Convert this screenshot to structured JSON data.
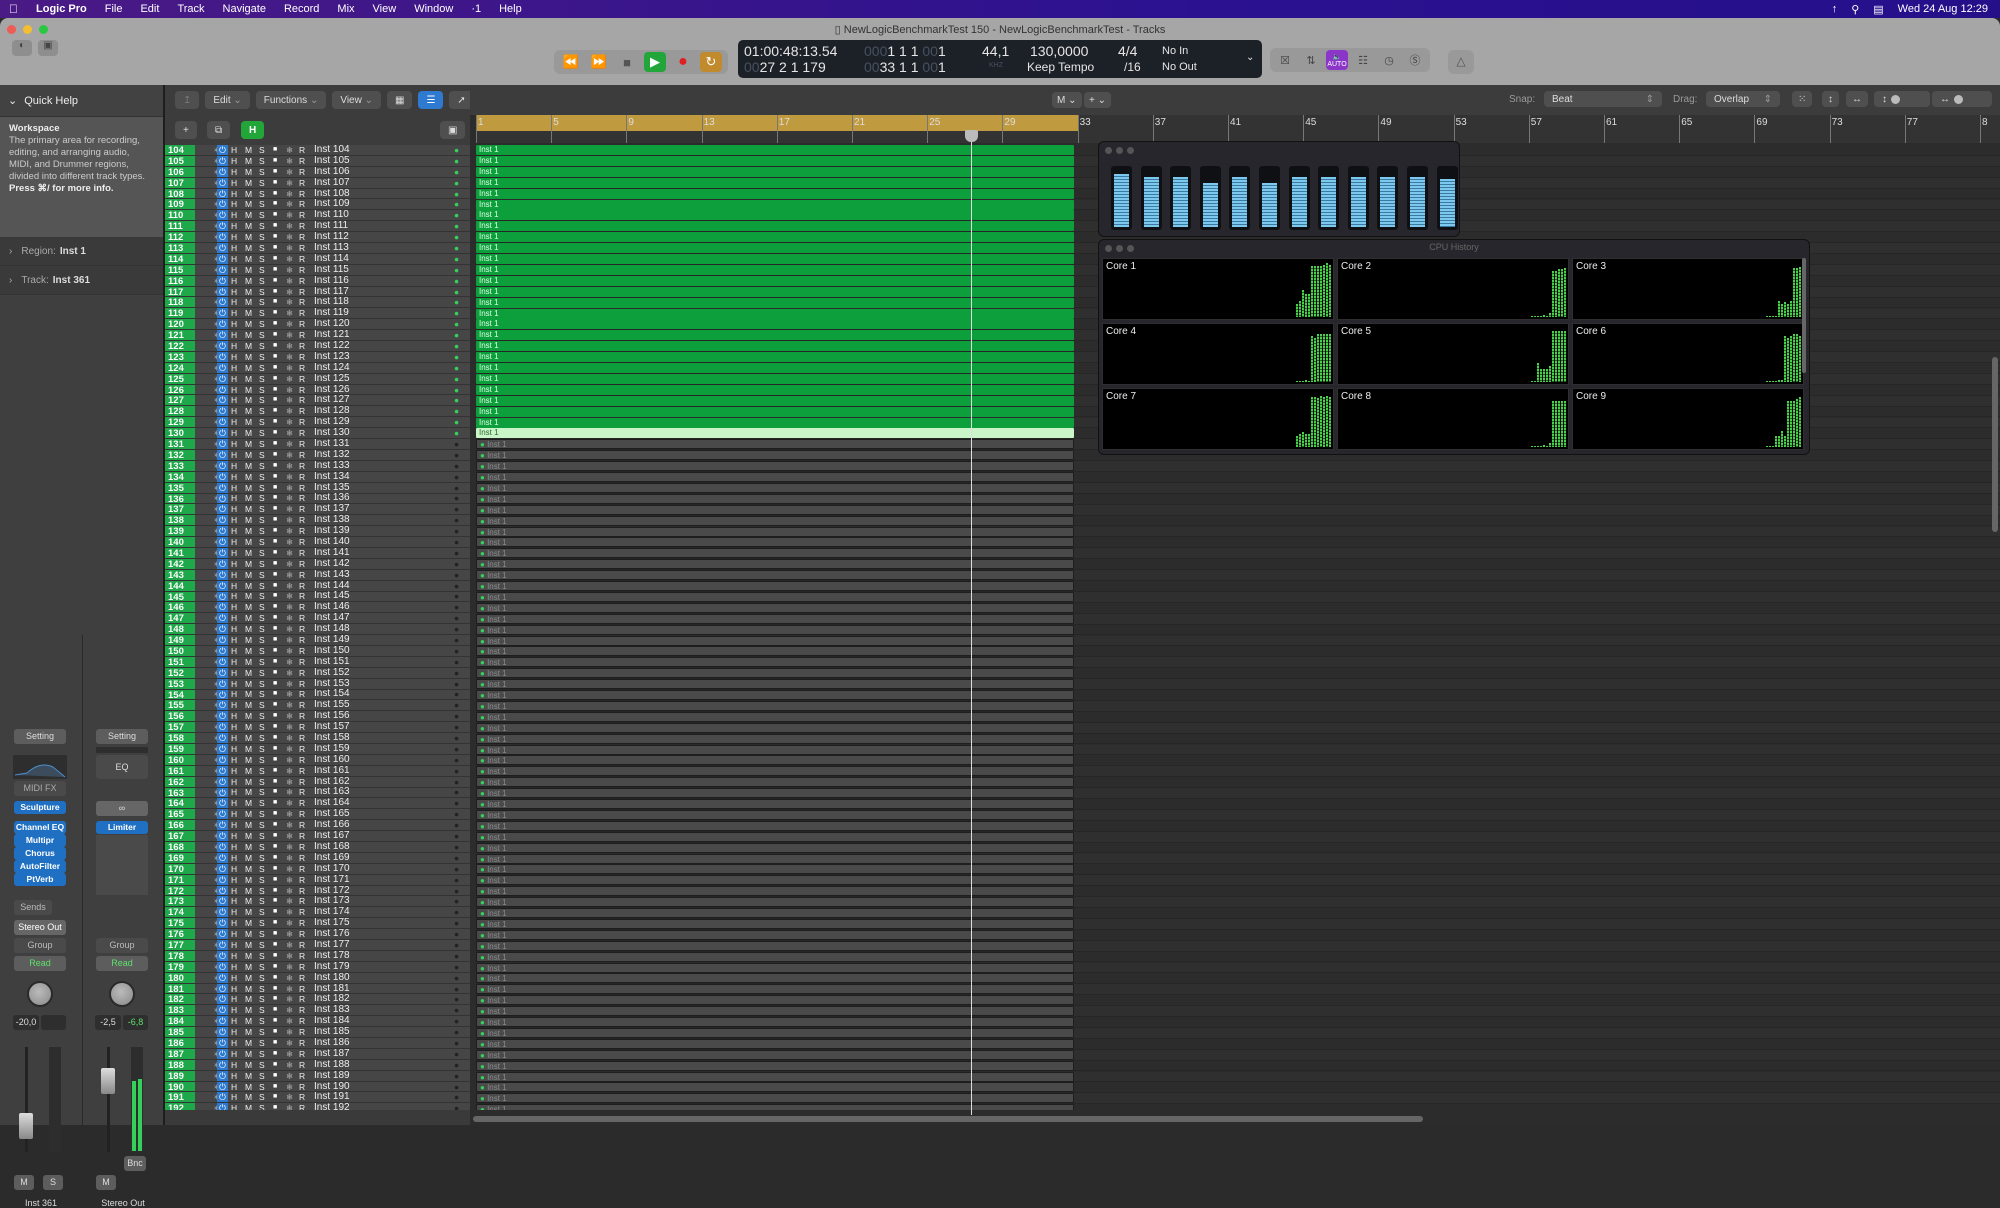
{
  "menubar": {
    "apple": "",
    "app": "Logic Pro",
    "items": [
      "File",
      "Edit",
      "Track",
      "Navigate",
      "Record",
      "Mix",
      "View",
      "Window",
      "·1",
      "Help"
    ],
    "clock": "Wed 24 Aug  12:29"
  },
  "window": {
    "title": "NewLogicBenchmarkTest 150 - NewLogicBenchmarkTest - Tracks"
  },
  "lcd": {
    "smpte": "01:00:48:13.54",
    "bars_top_dim": "000",
    "bars_top": "1  1  1",
    "bars_top_dim2": "00",
    "bars_top_end": "1",
    "pos_bottom_dim": "00",
    "pos_bottom": "27  2  1  179",
    "end_dim": "00",
    "end_top": "33  1  1",
    "end_dim2": "00",
    "end_end": "1",
    "sample_rate": "44,1",
    "sample_unit": "KHZ",
    "tempo": "130,0000",
    "tempo_mode": "Keep Tempo",
    "sig": "4/4",
    "div": "/16",
    "in": "No In",
    "out": "No Out"
  },
  "right_tools": {
    "auto_label": "AUTO"
  },
  "quick_help": {
    "header": "Quick Help",
    "title": "Workspace",
    "body": "The primary area for recording, editing, and arranging audio, MIDI, and Drummer regions, divided into different track types.",
    "hint": "Press ⌘/ for more info."
  },
  "inspector": {
    "region_label": "Region:",
    "region_value": "Inst 1",
    "track_label": "Track:",
    "track_value": "Inst 361"
  },
  "channel_strips": [
    {
      "setting": "Setting",
      "midi_fx": "MIDI FX",
      "instrument": "Sculpture",
      "plugins": [
        "Channel EQ",
        "Multipr",
        "Chorus",
        "AutoFilter",
        "PtVerb"
      ],
      "sends": "Sends",
      "output": "Stereo Out",
      "group": "Group",
      "automation": "Read",
      "volume": "-20,0",
      "peak": "",
      "mute": "M",
      "solo": "S",
      "name": "Inst 361"
    },
    {
      "setting": "Setting",
      "eq": "EQ",
      "link": "∞",
      "plugins": [
        "Limiter"
      ],
      "group": "Group",
      "automation": "Read",
      "volume": "-2,5",
      "peak": "-6,8",
      "bounce": "Bnc",
      "mute": "M",
      "name": "Stereo Out"
    }
  ],
  "tracks_toolbar": {
    "edit": "Edit",
    "functions": "Functions",
    "view": "View",
    "hide_label": "H"
  },
  "arrange_toolbar": {
    "snap_label": "Snap:",
    "snap_value": "Beat",
    "drag_label": "Drag:",
    "drag_value": "Overlap",
    "tool1": "M",
    "tool2": "+"
  },
  "ruler": {
    "bars": [
      "1",
      "5",
      "9",
      "13",
      "17",
      "21",
      "25",
      "29",
      "33",
      "37",
      "41",
      "45",
      "49",
      "53",
      "57",
      "61",
      "65",
      "69",
      "73",
      "77",
      "8"
    ]
  },
  "track_row_controls": {
    "hide": "H",
    "mute": "M",
    "solo": "S",
    "record": "R"
  },
  "tracks": {
    "first": 104,
    "last": 192,
    "prefix": "Inst ",
    "active_through": 130,
    "selected": 130,
    "region_name": "Inst 1"
  },
  "cpu_meter": {
    "levels": [
      0.92,
      0.86,
      0.86,
      0.76,
      0.86,
      0.76,
      0.86,
      0.86,
      0.86,
      0.86,
      0.86,
      0.82
    ]
  },
  "cpu_history": {
    "title": "CPU History",
    "cores": [
      {
        "name": "Core 1",
        "history": [
          0.25,
          0.3,
          0.5,
          0.42,
          0.42,
          0.95,
          0.95,
          0.95,
          0.95,
          0.97,
          1,
          0.97
        ]
      },
      {
        "name": "Core 2",
        "history": [
          0,
          0,
          0,
          0,
          0.03,
          0,
          0.08,
          0.85,
          0.85,
          0.88,
          0.88,
          0.9
        ]
      },
      {
        "name": "Core 3",
        "history": [
          0,
          0,
          0,
          0,
          0.3,
          0.25,
          0.28,
          0.25,
          0.3,
          0.9,
          0.9,
          0.92
        ]
      },
      {
        "name": "Core 4",
        "history": [
          0,
          0,
          0,
          0.03,
          0,
          0.85,
          0.82,
          0.88,
          0.88,
          0.88,
          0.88,
          0.88
        ]
      },
      {
        "name": "Core 5",
        "history": [
          0,
          0,
          0.35,
          0.25,
          0.25,
          0.25,
          0.3,
          0.95,
          0.95,
          0.95,
          0.95,
          0.95
        ]
      },
      {
        "name": "Core 6",
        "history": [
          0,
          0,
          0,
          0,
          0.03,
          0.03,
          0.85,
          0.82,
          0.85,
          0.88,
          0.88,
          0.85
        ]
      },
      {
        "name": "Core 7",
        "history": [
          0.2,
          0.25,
          0.28,
          0.25,
          0.25,
          0.92,
          0.92,
          0.9,
          0.95,
          0.92,
          0.95,
          0.92
        ]
      },
      {
        "name": "Core 8",
        "history": [
          0,
          0,
          0,
          0,
          0.03,
          0,
          0.08,
          0.85,
          0.85,
          0.85,
          0.85,
          0.85
        ]
      },
      {
        "name": "Core 9",
        "history": [
          0,
          0,
          0,
          0.2,
          0.2,
          0.3,
          0.2,
          0.85,
          0.85,
          0.85,
          0.88,
          0.92
        ]
      }
    ]
  },
  "colors": {
    "track_number": "#1ea84a",
    "region_active": "#0e9f3d",
    "region_selected": "#c9f5c9",
    "cycle": "#bf9a3f",
    "plugin": "#1f6fc2",
    "auto": "#8b35c9",
    "play": "#22a63a",
    "record": "#e02020"
  }
}
